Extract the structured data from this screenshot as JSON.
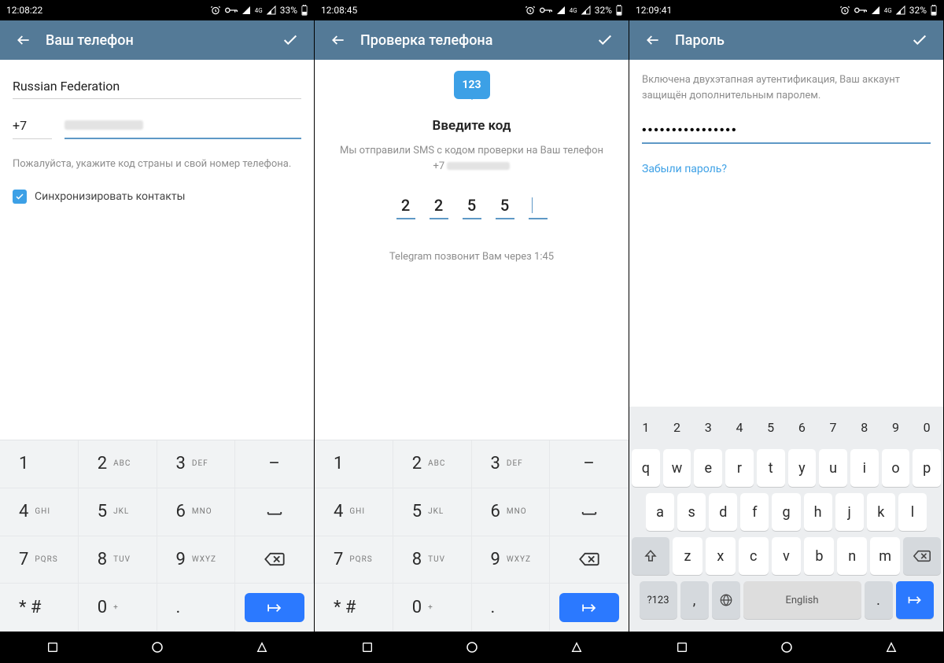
{
  "screens": [
    {
      "status": {
        "time": "12:08:22",
        "battery": "33%"
      },
      "appbar": {
        "title": "Ваш телефон"
      },
      "phone": {
        "country": "Russian Federation",
        "dial_code": "+7",
        "hint": "Пожалуйста, укажите код страны и свой номер телефона.",
        "sync_label": "Синхронизировать контакты"
      }
    },
    {
      "status": {
        "time": "12:08:45",
        "battery": "32%"
      },
      "appbar": {
        "title": "Проверка телефона"
      },
      "verify": {
        "bubble": "123",
        "title": "Введите код",
        "subtitle": "Мы отправили SMS с кодом проверки на Ваш телефон",
        "phone_prefix": "+7",
        "code": [
          "2",
          "2",
          "5",
          "5",
          ""
        ],
        "countdown": "Telegram позвонит Вам через 1:45"
      }
    },
    {
      "status": {
        "time": "12:09:41",
        "battery": "32%"
      },
      "appbar": {
        "title": "Пароль"
      },
      "password": {
        "hint": "Включена двухэтапная аутентификация, Ваш аккаунт защищён дополнительным паролем.",
        "value": "••••••••••••••••",
        "forgot": "Забыли пароль?"
      }
    }
  ],
  "numpad": {
    "rows": [
      [
        {
          "d": "1",
          "s": ""
        },
        {
          "d": "2",
          "s": "ABC"
        },
        {
          "d": "3",
          "s": "DEF"
        },
        {
          "d": "–",
          "s": ""
        }
      ],
      [
        {
          "d": "4",
          "s": "GHI"
        },
        {
          "d": "5",
          "s": "JKL"
        },
        {
          "d": "6",
          "s": "MNO"
        },
        {
          "d": "␣",
          "s": ""
        }
      ],
      [
        {
          "d": "7",
          "s": "PQRS"
        },
        {
          "d": "8",
          "s": "TUV"
        },
        {
          "d": "9",
          "s": "WXYZ"
        },
        {
          "d": "⌫",
          "s": ""
        }
      ],
      [
        {
          "d": "* #",
          "s": ""
        },
        {
          "d": "0",
          "s": "+"
        },
        {
          "d": ".",
          "s": ""
        },
        {
          "d": "↵",
          "s": ""
        }
      ]
    ]
  },
  "qwerty": {
    "numrow": [
      "1",
      "2",
      "3",
      "4",
      "5",
      "6",
      "7",
      "8",
      "9",
      "0"
    ],
    "row1": [
      "q",
      "w",
      "e",
      "r",
      "t",
      "y",
      "u",
      "i",
      "o",
      "p"
    ],
    "row2": [
      "a",
      "s",
      "d",
      "f",
      "g",
      "h",
      "j",
      "k",
      "l"
    ],
    "row3": [
      "z",
      "x",
      "c",
      "v",
      "b",
      "n",
      "m"
    ],
    "sym": "?123",
    "comma": ",",
    "dot": ".",
    "space": "English"
  }
}
